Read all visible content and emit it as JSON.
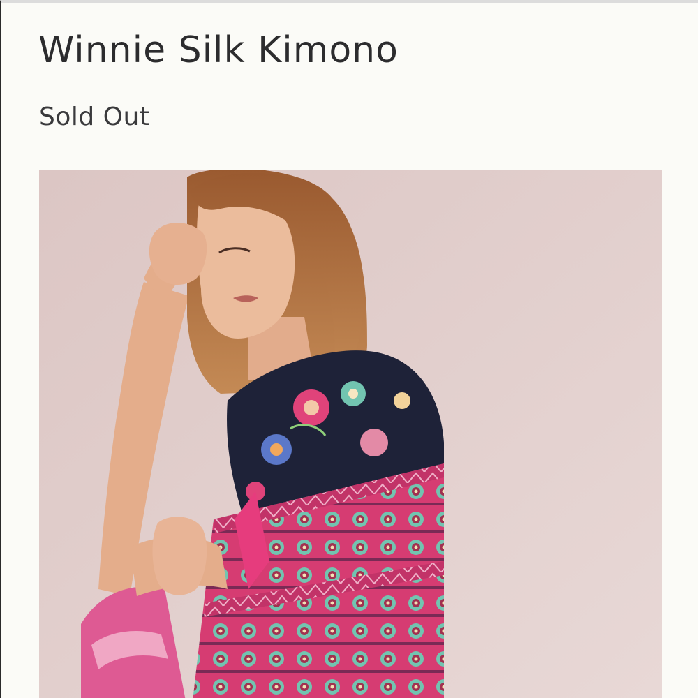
{
  "product": {
    "title": "Winnie Silk Kimono",
    "status": "Sold Out"
  },
  "image": {
    "description_name": "product-photo",
    "backdrop_color": "#e4d2d0",
    "hair_color": "#a8683a",
    "skin_color": "#e9b797",
    "kimono_dark_color": "#1e2238",
    "kimono_pink_color": "#e0437a",
    "kimono_accent_color": "#72c4b0"
  }
}
